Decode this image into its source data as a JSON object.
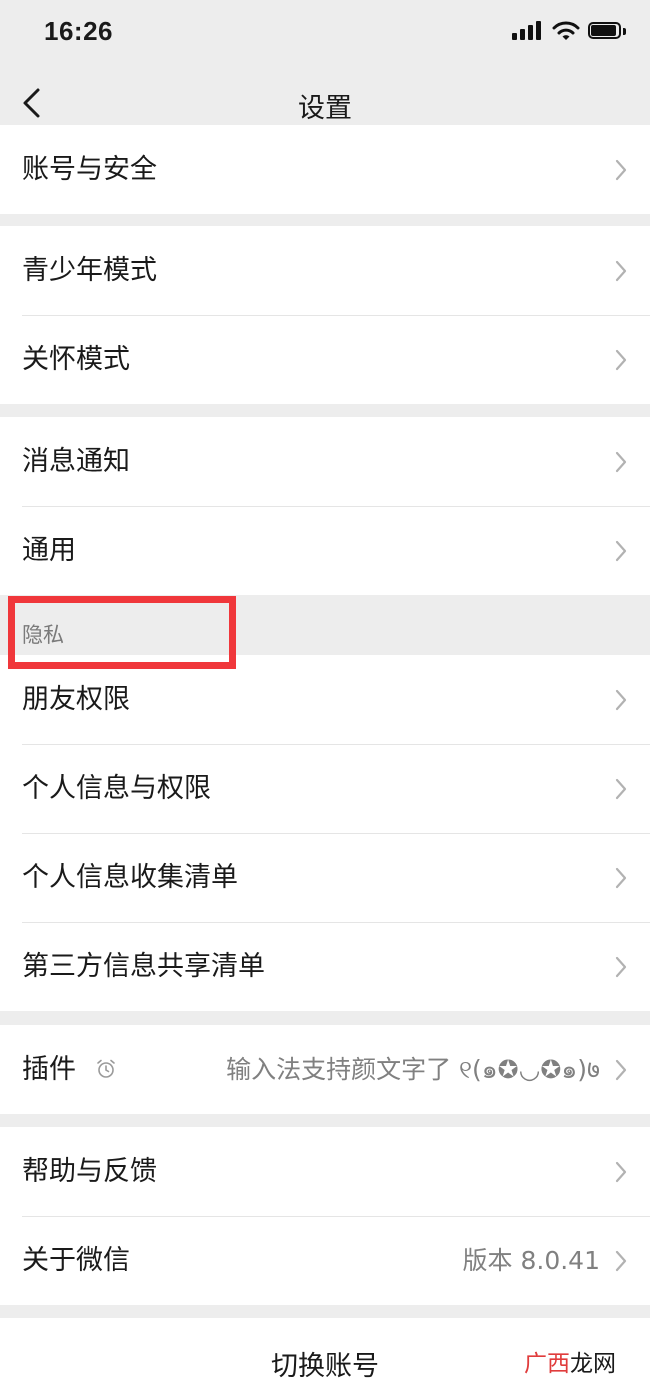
{
  "status_bar": {
    "time": "16:26"
  },
  "nav": {
    "title": "设置"
  },
  "groups": {
    "account": [
      "账号与安全"
    ],
    "modes": [
      "青少年模式",
      "关怀模式"
    ],
    "general": [
      "消息通知",
      "通用"
    ],
    "privacy_header": "隐私",
    "privacy": [
      "朋友权限",
      "个人信息与权限",
      "个人信息收集清单",
      "第三方信息共享清单"
    ],
    "plugins": {
      "label": "插件",
      "detail": "输入法支持颜文字了 ୧(๑✪◡✪๑)७"
    },
    "help": [
      "帮助与反馈"
    ],
    "about": {
      "label": "关于微信",
      "detail": "版本 8.0.41"
    }
  },
  "switch_account": "切换账号",
  "watermark": {
    "part_a": "广西",
    "part_b": "龙网"
  },
  "colors": {
    "highlight": "#f0373b",
    "background": "#ededed"
  }
}
